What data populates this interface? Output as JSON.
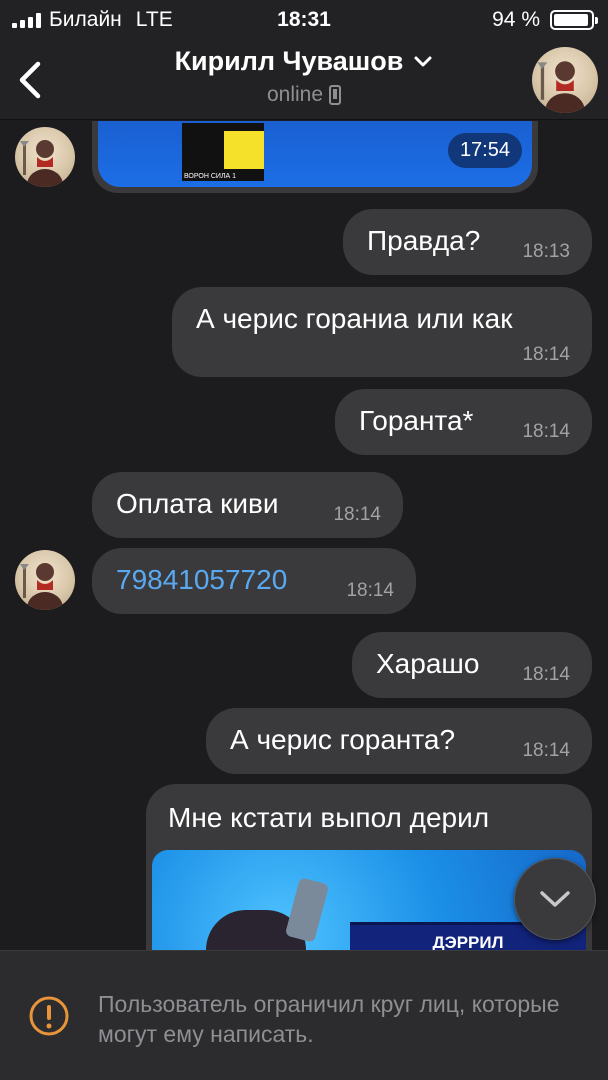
{
  "status_bar": {
    "carrier": "Билайн",
    "network": "LTE",
    "time": "18:31",
    "battery": "94 %",
    "battery_level": 0.94
  },
  "header": {
    "contact_name": "Кирилл Чувашов",
    "status": "online"
  },
  "media_top": {
    "duration": "17:54",
    "card_labels": [
      "ВОРОН",
      "СИЛА 1"
    ]
  },
  "messages": [
    {
      "text": "Правда?",
      "time": "18:13",
      "direction": "out"
    },
    {
      "text": "А черис гораниа или как",
      "time": "18:14",
      "direction": "out"
    },
    {
      "text": "Горанта*",
      "time": "18:14",
      "direction": "out"
    },
    {
      "text": "Оплата киви",
      "time": "18:14",
      "direction": "in"
    },
    {
      "text": "79841057720",
      "time": "18:14",
      "direction": "in",
      "is_link": true
    },
    {
      "text": "Харашо",
      "time": "18:14",
      "direction": "out"
    },
    {
      "text": "А черис горанта?",
      "time": "18:14",
      "direction": "out"
    }
  ],
  "media_bottom": {
    "caption": "Мне кстати выпол дерил",
    "banner": "ДЭРРИЛ"
  },
  "footer": {
    "notice": "Пользователь ограничил круг лиц, которые могут ему написать."
  },
  "colors": {
    "background": "#1c1c1e",
    "bubble": "#3a3a3c",
    "link": "#5aa9f0",
    "warning": "#e8943a"
  }
}
